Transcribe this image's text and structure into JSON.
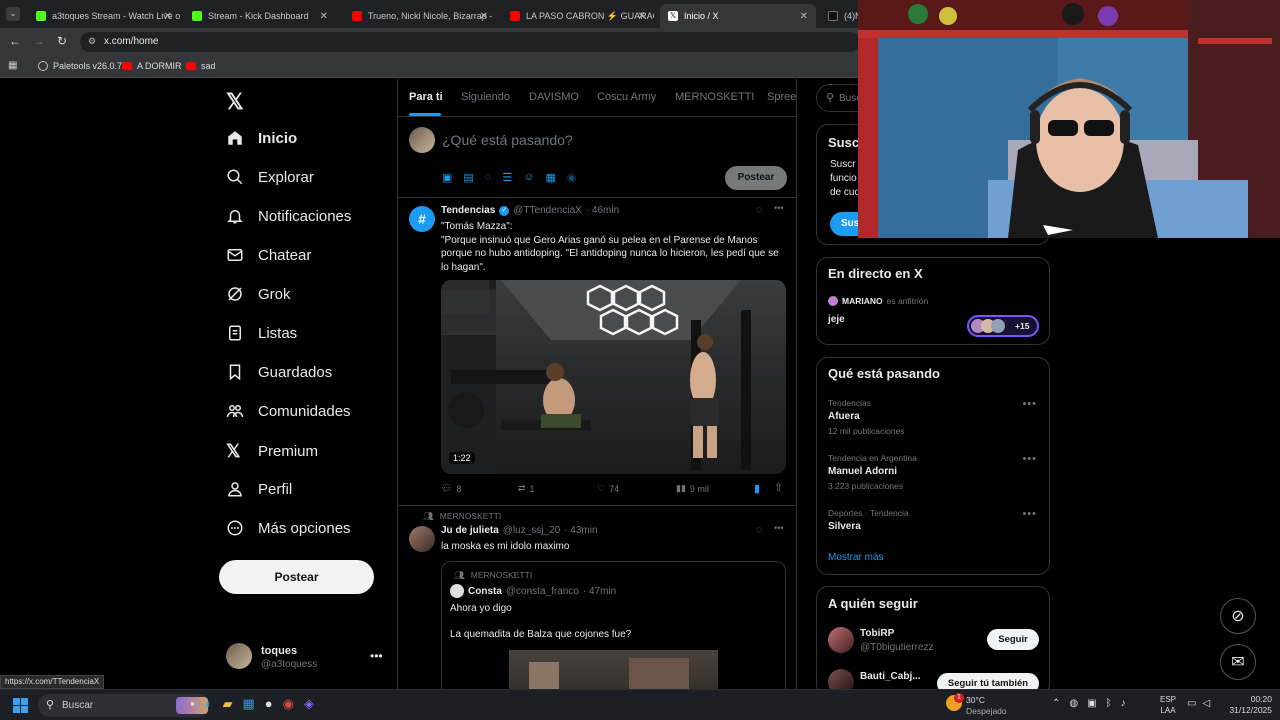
{
  "browser": {
    "tabs": [
      {
        "label": "a3toques Stream - Watch Live o",
        "color": "#53fc18"
      },
      {
        "label": "Stream - Kick Dashboard",
        "color": "#53fc18"
      },
      {
        "label": "Trueno, Nicki Nicole, Bizarrap -",
        "color": "#ff0000"
      },
      {
        "label": "LA PASO CABRON ⚡ GUARACH",
        "color": "#ff0000"
      },
      {
        "label": "Inicio / X",
        "color": "#ffffff"
      },
      {
        "label": "(4)N",
        "color": "#ffffff"
      }
    ],
    "url": "x.com/home",
    "bookmarks": [
      "Paletools v26.0.7",
      "A DORMIR",
      "sad"
    ],
    "status_url": "https://x.com/TTendenciaX"
  },
  "nav": {
    "items": [
      "Inicio",
      "Explorar",
      "Notificaciones",
      "Chatear",
      "Grok",
      "Listas",
      "Guardados",
      "Comunidades",
      "Premium",
      "Perfil",
      "Más opciones"
    ],
    "post_button": "Postear",
    "account": {
      "name": "toques",
      "handle": "@a3toquess"
    }
  },
  "feed": {
    "tabs": [
      "Para ti",
      "Siguiendo",
      "DAVISMO",
      "Coscu Army",
      "MERNOSKETTI",
      "Spree"
    ],
    "composer_placeholder": "¿Qué está pasando?",
    "composer_button": "Postear",
    "tweet1": {
      "name": "Tendencias",
      "handle": "@TTendenciaX",
      "time": "· 46min",
      "text": "\"Tomás Mazza\":\n\"Porque insinuó que Gero Arias ganó su pelea en el Parense de Manos porque no hubo antidoping. \"El antidoping nunca lo hicieron, les pedí que se lo hagan\".",
      "video_duration": "1:22",
      "replies": "8",
      "reposts": "1",
      "likes": "74",
      "views": "9 mil"
    },
    "tweet2": {
      "community": "MERNOSKETTI",
      "name": "Ju de julieta",
      "handle": "@luz_ssj_20",
      "time": "· 43min",
      "text": "la moska es mi idolo maximo",
      "quote": {
        "community": "MERNOSKETTI",
        "name": "Consta",
        "handle": "@consta_franco",
        "time": "· 47min",
        "line1": "Ahora yo digo",
        "line2": "La quemadita de Balza que cojones fue?"
      }
    }
  },
  "right": {
    "search_placeholder": "Busc",
    "subscribe": {
      "title": "Susc",
      "line1": "Suscr",
      "line2": "funcio",
      "line3": "de cuo",
      "button": "Sus"
    },
    "live": {
      "title": "En directo en X",
      "host": "MARIANO",
      "host_suffix": "es anfitrión",
      "text": "jeje",
      "count": "+15"
    },
    "trending": {
      "title": "Qué está pasando",
      "items": [
        {
          "meta": "Tendencias",
          "name": "Afuera",
          "posts": "12 mil publicaciones"
        },
        {
          "meta": "Tendencia en Argentina",
          "name": "Manuel Adorni",
          "posts": "3.223 publicaciones"
        },
        {
          "meta": "Deportes · Tendencia",
          "name": "Silvera",
          "posts": ""
        }
      ],
      "more": "Mostrar más"
    },
    "who_to_follow": {
      "title": "A quién seguir",
      "items": [
        {
          "name": "TobiRP",
          "handle": "@T0bigutierrezz",
          "button": "Seguir"
        },
        {
          "name": "Bauti_Cabj...",
          "handle": "",
          "button": "Seguir tú también"
        }
      ]
    }
  },
  "taskbar": {
    "search": "Buscar",
    "weather_temp": "30°C",
    "weather_desc": "Despejado",
    "lang1": "ESP",
    "lang2": "LAA",
    "time": "00:20",
    "date": "31/12/2025",
    "badge": "1"
  },
  "colors": {
    "accent": "#1d9bf0",
    "bg": "#000000",
    "border": "#2f3336",
    "muted": "#71767b"
  }
}
